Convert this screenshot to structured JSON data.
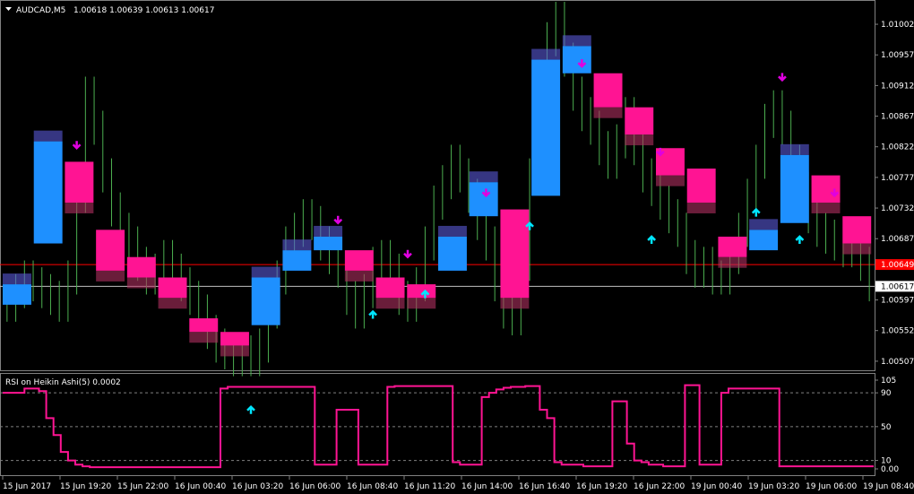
{
  "window": {
    "symbol_label": "AUDCAD,M5",
    "ohlc_label": "1.00618 1.00639 1.00613 1.00617",
    "menu_icon": "triangle-down-icon"
  },
  "colors": {
    "background": "#000000",
    "grid": "#808080",
    "bars": "#4caf50",
    "ha_bull": "#1e90ff",
    "ha_bear": "#ff1493",
    "ha_bull_wick": "#5a5ad8",
    "ha_bear_wick": "#b03060",
    "arrow_down": "#e000e0",
    "arrow_up": "#00e5ff",
    "rsi_line": "#ff1493",
    "red_line": "#ff0000",
    "current_price_line": "#c0c0c0"
  },
  "chart_data": [
    {
      "type": "line",
      "title": "AUDCAD,M5",
      "subtitle": "1.00618 1.00639 1.00613 1.00617",
      "ylim": [
        1.00495,
        1.01035
      ],
      "y_ticks": [
        "1.01002",
        "1.00957",
        "1.00912",
        "1.00867",
        "1.00822",
        "1.00777",
        "1.00732",
        "1.00687",
        "1.00597",
        "1.00552",
        "1.00507"
      ],
      "price_badges": [
        {
          "label": "1.00649",
          "value": 1.00649,
          "style": "red"
        },
        {
          "label": "1.00617",
          "value": 1.00617,
          "style": "white"
        }
      ],
      "x_ticks": [
        "15 Jun 2017",
        "15 Jun 19:20",
        "15 Jun 22:00",
        "16 Jun 00:40",
        "16 Jun 03:20",
        "16 Jun 06:00",
        "16 Jun 08:40",
        "16 Jun 11:20",
        "16 Jun 14:00",
        "16 Jun 16:40",
        "16 Jun 19:20",
        "16 Jun 22:00",
        "19 Jun 00:40",
        "19 Jun 03:20",
        "19 Jun 06:00",
        "19 Jun 08:40"
      ],
      "series": [
        {
          "name": "Close",
          "values": [
            1.0059,
            1.0061,
            1.0063,
            1.0062,
            1.0061,
            1.006,
            1.0059,
            1.0063,
            1.0075,
            1.009,
            1.0085,
            1.0078,
            1.0073,
            1.007,
            1.0068,
            1.0065,
            1.0063,
            1.0064,
            1.0066,
            1.0064,
            1.0062,
            1.006,
            1.0058,
            1.0055,
            1.0053,
            1.0052,
            1.0051,
            1.0052,
            1.0051,
            1.0053,
            1.0058,
            1.0063,
            1.0068,
            1.007,
            1.0072,
            1.0071,
            1.0068,
            1.0066,
            1.0064,
            1.006,
            1.0058,
            1.0061,
            1.0065,
            1.0066,
            1.0064,
            1.006,
            1.0059,
            1.0062,
            1.0068,
            1.0074,
            1.0077,
            1.008,
            1.0078,
            1.0075,
            1.0071,
            1.0068,
            1.0062,
            1.0058,
            1.0057,
            1.0065,
            1.0078,
            1.0088,
            1.0098,
            1.0101,
            1.0095,
            1.009,
            1.0087,
            1.0085,
            1.0082,
            1.008,
            1.0083,
            1.0087,
            1.0082,
            1.0078,
            1.0076,
            1.0074,
            1.0072,
            1.007,
            1.0066,
            1.0064,
            1.0065,
            1.0063,
            1.0063,
            1.0066,
            1.007,
            1.0075,
            1.008,
            1.0086,
            1.0088,
            1.0085,
            1.008,
            1.0076,
            1.0072,
            1.007,
            1.0069,
            1.0068,
            1.0067,
            1.0067,
            1.0065,
            1.0062
          ]
        }
      ],
      "heikin_ashi_blocks": [
        {
          "dir": "up",
          "open": 1.0059,
          "close": 1.0062
        },
        {
          "dir": "up",
          "open": 1.0068,
          "close": 1.0083
        },
        {
          "dir": "down",
          "open": 1.008,
          "close": 1.0074
        },
        {
          "dir": "down",
          "open": 1.007,
          "close": 1.0064
        },
        {
          "dir": "down",
          "open": 1.0066,
          "close": 1.0063
        },
        {
          "dir": "down",
          "open": 1.0063,
          "close": 1.006
        },
        {
          "dir": "down",
          "open": 1.0057,
          "close": 1.0055
        },
        {
          "dir": "down",
          "open": 1.0055,
          "close": 1.0053
        },
        {
          "dir": "up",
          "open": 1.0056,
          "close": 1.0063
        },
        {
          "dir": "up",
          "open": 1.0064,
          "close": 1.0067
        },
        {
          "dir": "up",
          "open": 1.0067,
          "close": 1.0069
        },
        {
          "dir": "down",
          "open": 1.0067,
          "close": 1.0064
        },
        {
          "dir": "down",
          "open": 1.0063,
          "close": 1.006
        },
        {
          "dir": "down",
          "open": 1.0062,
          "close": 1.006
        },
        {
          "dir": "up",
          "open": 1.0064,
          "close": 1.0069
        },
        {
          "dir": "up",
          "open": 1.0072,
          "close": 1.0077
        },
        {
          "dir": "down",
          "open": 1.0073,
          "close": 1.006
        },
        {
          "dir": "up",
          "open": 1.0075,
          "close": 1.0095
        },
        {
          "dir": "up",
          "open": 1.0093,
          "close": 1.0097
        },
        {
          "dir": "down",
          "open": 1.0093,
          "close": 1.0088
        },
        {
          "dir": "down",
          "open": 1.0088,
          "close": 1.0084
        },
        {
          "dir": "down",
          "open": 1.0082,
          "close": 1.0078
        },
        {
          "dir": "down",
          "open": 1.0079,
          "close": 1.0074
        },
        {
          "dir": "down",
          "open": 1.0069,
          "close": 1.0066
        },
        {
          "dir": "up",
          "open": 1.0067,
          "close": 1.007
        },
        {
          "dir": "up",
          "open": 1.0071,
          "close": 1.0081
        },
        {
          "dir": "down",
          "open": 1.0078,
          "close": 1.0074
        },
        {
          "dir": "down",
          "open": 1.0072,
          "close": 1.0068
        }
      ],
      "signal_arrows": [
        {
          "dir": "down",
          "x_index": 8
        },
        {
          "dir": "up",
          "x_index": 28
        },
        {
          "dir": "down",
          "x_index": 38
        },
        {
          "dir": "up",
          "x_index": 42
        },
        {
          "dir": "down",
          "x_index": 46
        },
        {
          "dir": "up",
          "x_index": 48
        },
        {
          "dir": "down",
          "x_index": 55
        },
        {
          "dir": "up",
          "x_index": 60
        },
        {
          "dir": "down",
          "x_index": 66
        },
        {
          "dir": "up",
          "x_index": 74
        },
        {
          "dir": "down",
          "x_index": 75
        },
        {
          "dir": "up",
          "x_index": 86
        },
        {
          "dir": "down",
          "x_index": 89
        },
        {
          "dir": "up",
          "x_index": 91
        },
        {
          "dir": "down",
          "x_index": 95
        }
      ],
      "grid": false
    },
    {
      "type": "line",
      "title": "RSI on Heikin Ashi(5) 0.0002",
      "ylim": [
        0,
        105
      ],
      "y_ticks": [
        "105",
        "90",
        "50",
        "10",
        "0.00"
      ],
      "levels": [
        90,
        50,
        10
      ],
      "series": [
        {
          "name": "RSI on Heikin Ashi(5)",
          "values": [
            90,
            90,
            90,
            95,
            95,
            92,
            60,
            40,
            20,
            10,
            5,
            3,
            2,
            2,
            2,
            2,
            2,
            2,
            2,
            2,
            2,
            2,
            2,
            2,
            2,
            2,
            2,
            2,
            2,
            2,
            95,
            97,
            97,
            97,
            97,
            97,
            97,
            97,
            97,
            97,
            97,
            97,
            97,
            5,
            5,
            5,
            70,
            70,
            70,
            5,
            5,
            5,
            5,
            97,
            98,
            98,
            98,
            98,
            98,
            98,
            98,
            98,
            8,
            5,
            5,
            5,
            85,
            90,
            94,
            96,
            97,
            97,
            98,
            98,
            70,
            60,
            8,
            5,
            5,
            5,
            3,
            3,
            3,
            3,
            80,
            80,
            30,
            10,
            8,
            5,
            5,
            3,
            3,
            3,
            99,
            99,
            5,
            5,
            5,
            90,
            95,
            95,
            95,
            95,
            95,
            95,
            95,
            3,
            3,
            3,
            3,
            3,
            3,
            3,
            3,
            3,
            3,
            3,
            3,
            3
          ]
        }
      ]
    }
  ]
}
